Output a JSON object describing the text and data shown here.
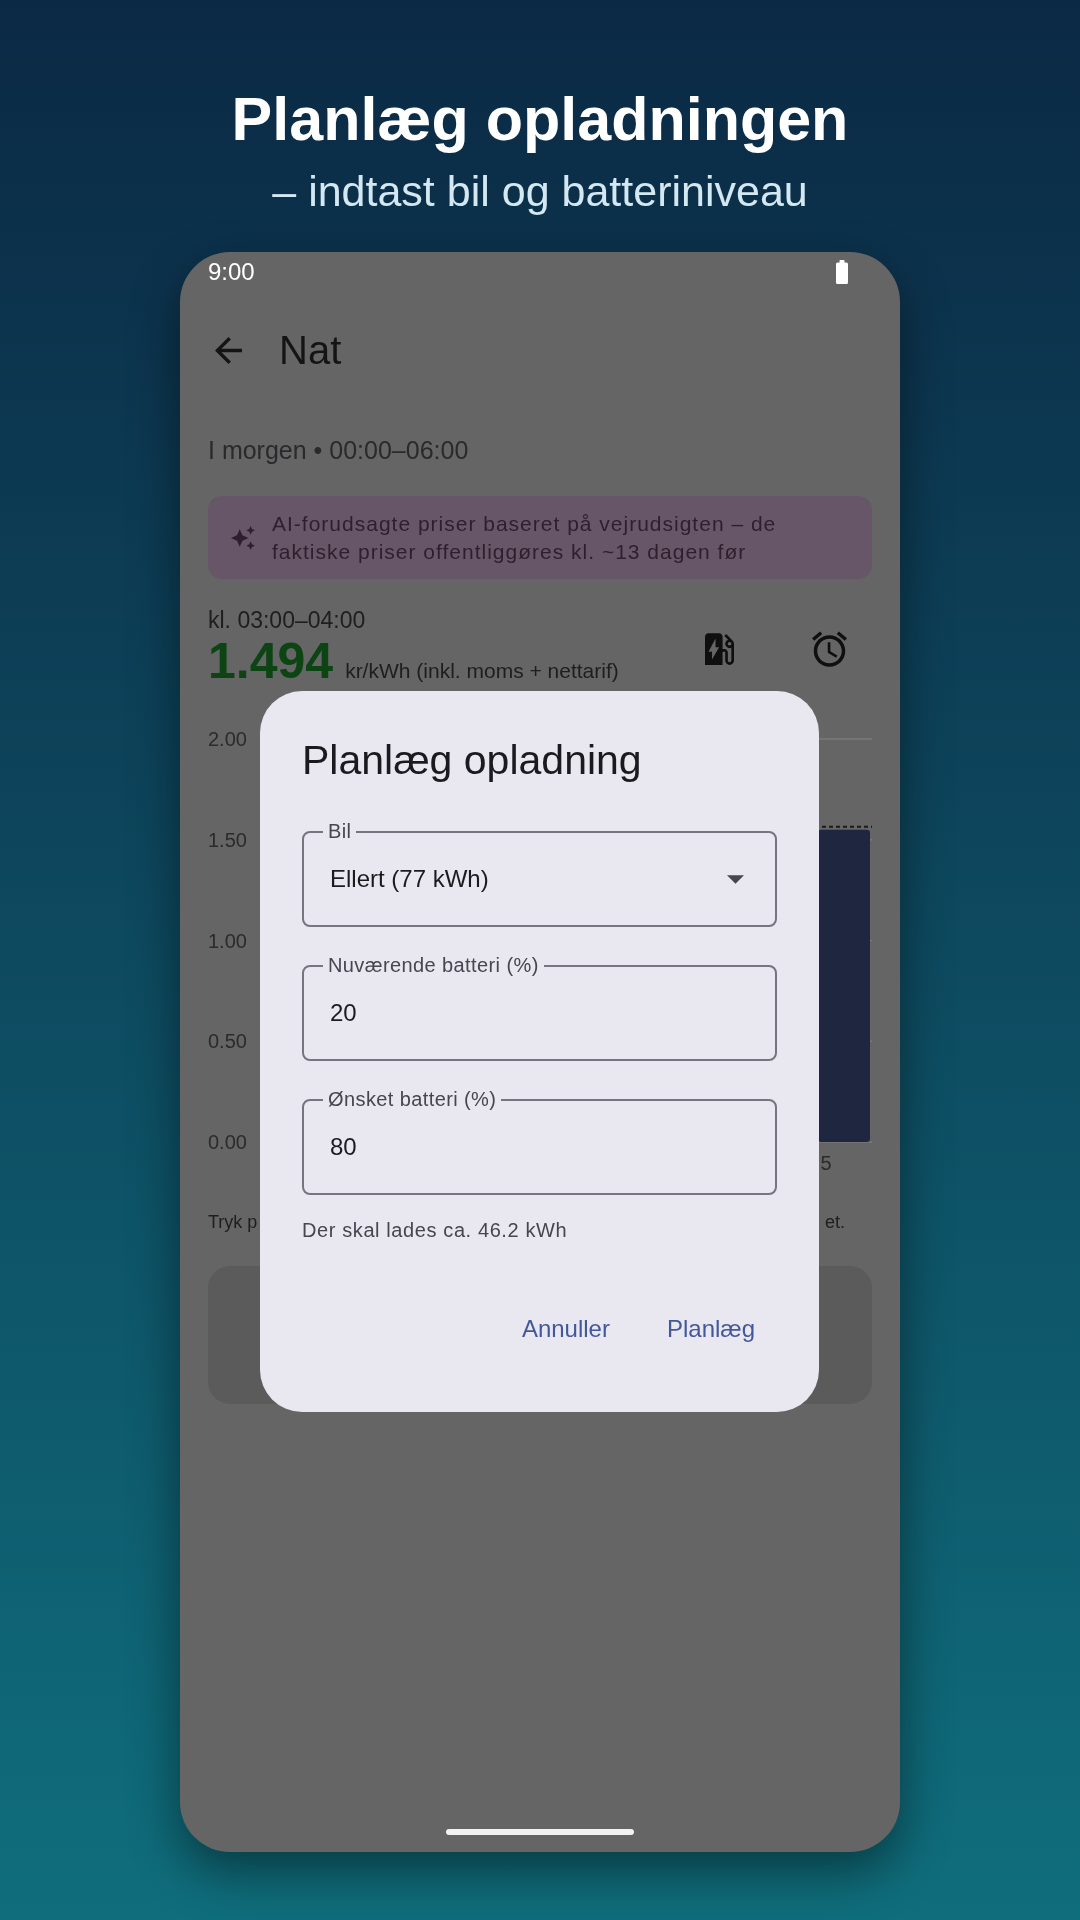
{
  "headline": {
    "title": "Planlæg opladningen",
    "subtitle": "– indtast bil og batteriniveau"
  },
  "status_bar": {
    "time": "9:00"
  },
  "app_bar": {
    "title": "Nat"
  },
  "period": {
    "text": "I morgen • 00:00–06:00"
  },
  "ai_banner": {
    "text": "AI-forudsagte priser baseret på vejrudsigten – de faktiske priser offentliggøres kl. ~13 dagen før"
  },
  "price": {
    "hour": "kl. 03:00–04:00",
    "value": "1.494",
    "unit": "kr/kWh (inkl. moms + nettarif)"
  },
  "chart": {
    "chart_data": {
      "type": "bar",
      "categories": [
        "5"
      ],
      "values": [
        1.55
      ],
      "ylim": [
        0,
        2
      ],
      "grid": true,
      "yticks": [
        {
          "value": 0,
          "label": "0.00"
        },
        {
          "value": 0.5,
          "label": "0.50"
        },
        {
          "value": 1,
          "label": "1.00"
        },
        {
          "value": 1.5,
          "label": "1.50"
        },
        {
          "value": 2,
          "label": "2.00"
        }
      ]
    }
  },
  "note": {
    "visible_start": "Tryk p",
    "visible_end": "et."
  },
  "dialog": {
    "title": "Planlæg opladning",
    "fields": [
      {
        "kind": "dropdown",
        "label": "Bil",
        "value": "Ellert (77 kWh)"
      },
      {
        "kind": "text",
        "label": "Nuværende batteri (%)",
        "value": "20"
      },
      {
        "kind": "text",
        "label": "Ønsket batteri (%)",
        "value": "80"
      }
    ],
    "hint": "Der skal lades ca. 46.2 kWh",
    "buttons": [
      "Annuller",
      "Planlæg"
    ]
  }
}
